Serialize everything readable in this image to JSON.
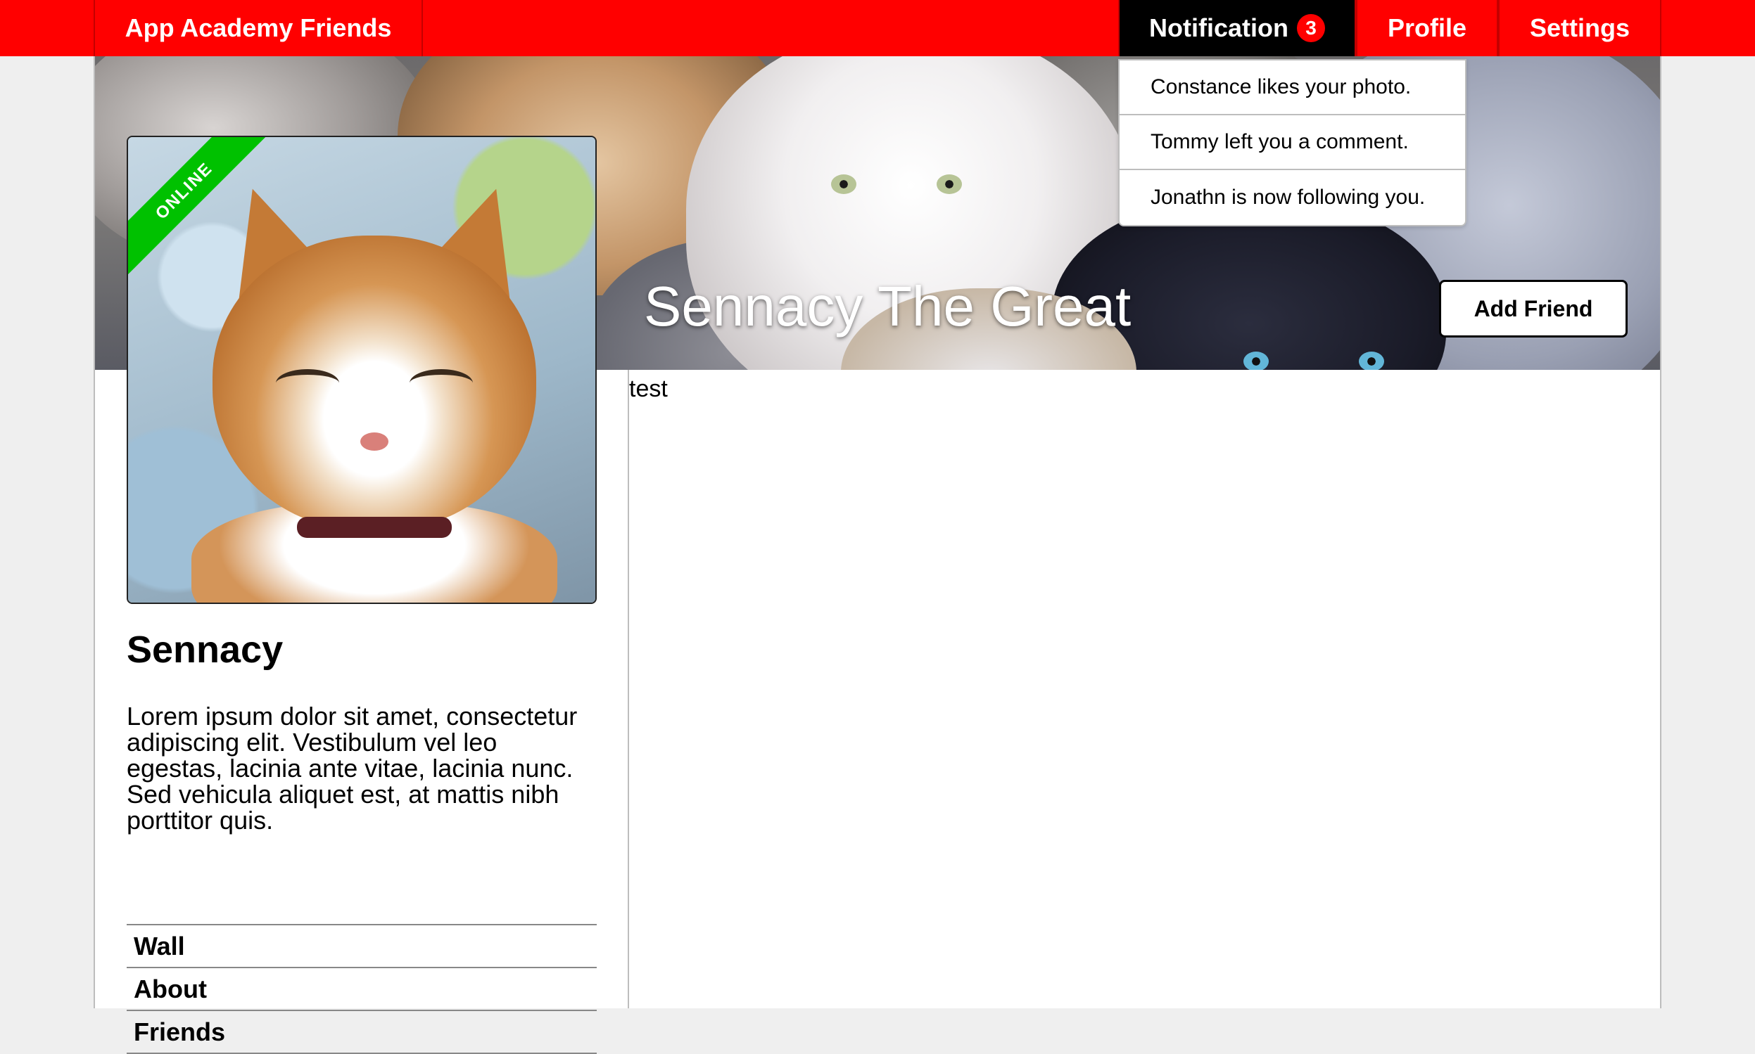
{
  "colors": {
    "nav_bg": "#ff0000",
    "nav_active_bg": "#000000",
    "badge_bg": "#ff0000",
    "online_ribbon": "#00c100"
  },
  "nav": {
    "brand": "App Academy Friends",
    "notifications_label": "Notification",
    "notifications_count": "3",
    "profile_label": "Profile",
    "settings_label": "Settings"
  },
  "notifications": [
    {
      "text": "Constance likes your photo."
    },
    {
      "text": "Tommy left you a comment."
    },
    {
      "text": "Jonathn is now following you."
    }
  ],
  "cover": {
    "title": "Sennacy The Great",
    "add_friend_label": "Add Friend"
  },
  "profile": {
    "status": "ONLINE",
    "name": "Sennacy",
    "bio": "Lorem ipsum dolor sit amet, consectetur adipiscing elit. Vestibulum vel leo egestas, lacinia ante vitae, lacinia nunc. Sed vehicula aliquet est, at mattis nibh porttitor quis.",
    "menu": [
      {
        "label": "Wall"
      },
      {
        "label": "About"
      },
      {
        "label": "Friends"
      }
    ]
  },
  "content": {
    "text": "test"
  }
}
